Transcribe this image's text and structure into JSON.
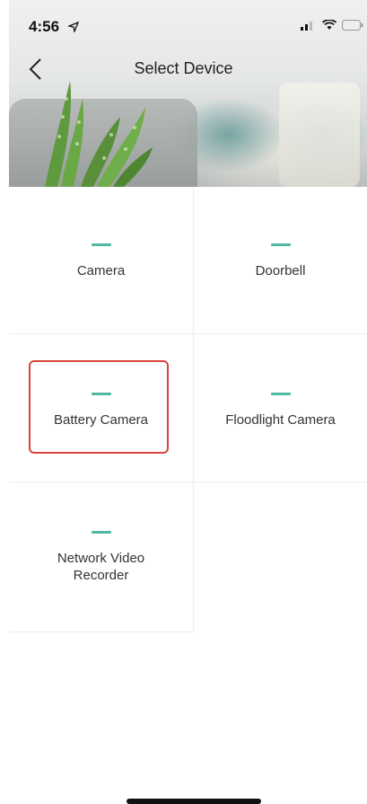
{
  "status_bar": {
    "time": "4:56"
  },
  "nav": {
    "title": "Select Device",
    "back_icon": "chevron-left-icon"
  },
  "devices": [
    {
      "label": "Camera",
      "selected": false
    },
    {
      "label": "Doorbell",
      "selected": false
    },
    {
      "label": "Battery Camera",
      "selected": true
    },
    {
      "label": "Floodlight Camera",
      "selected": false
    },
    {
      "label": "Network Video\nRecorder",
      "selected": false
    }
  ],
  "colors": {
    "accent": "#4fb8a4",
    "highlight": "#d7453d"
  }
}
